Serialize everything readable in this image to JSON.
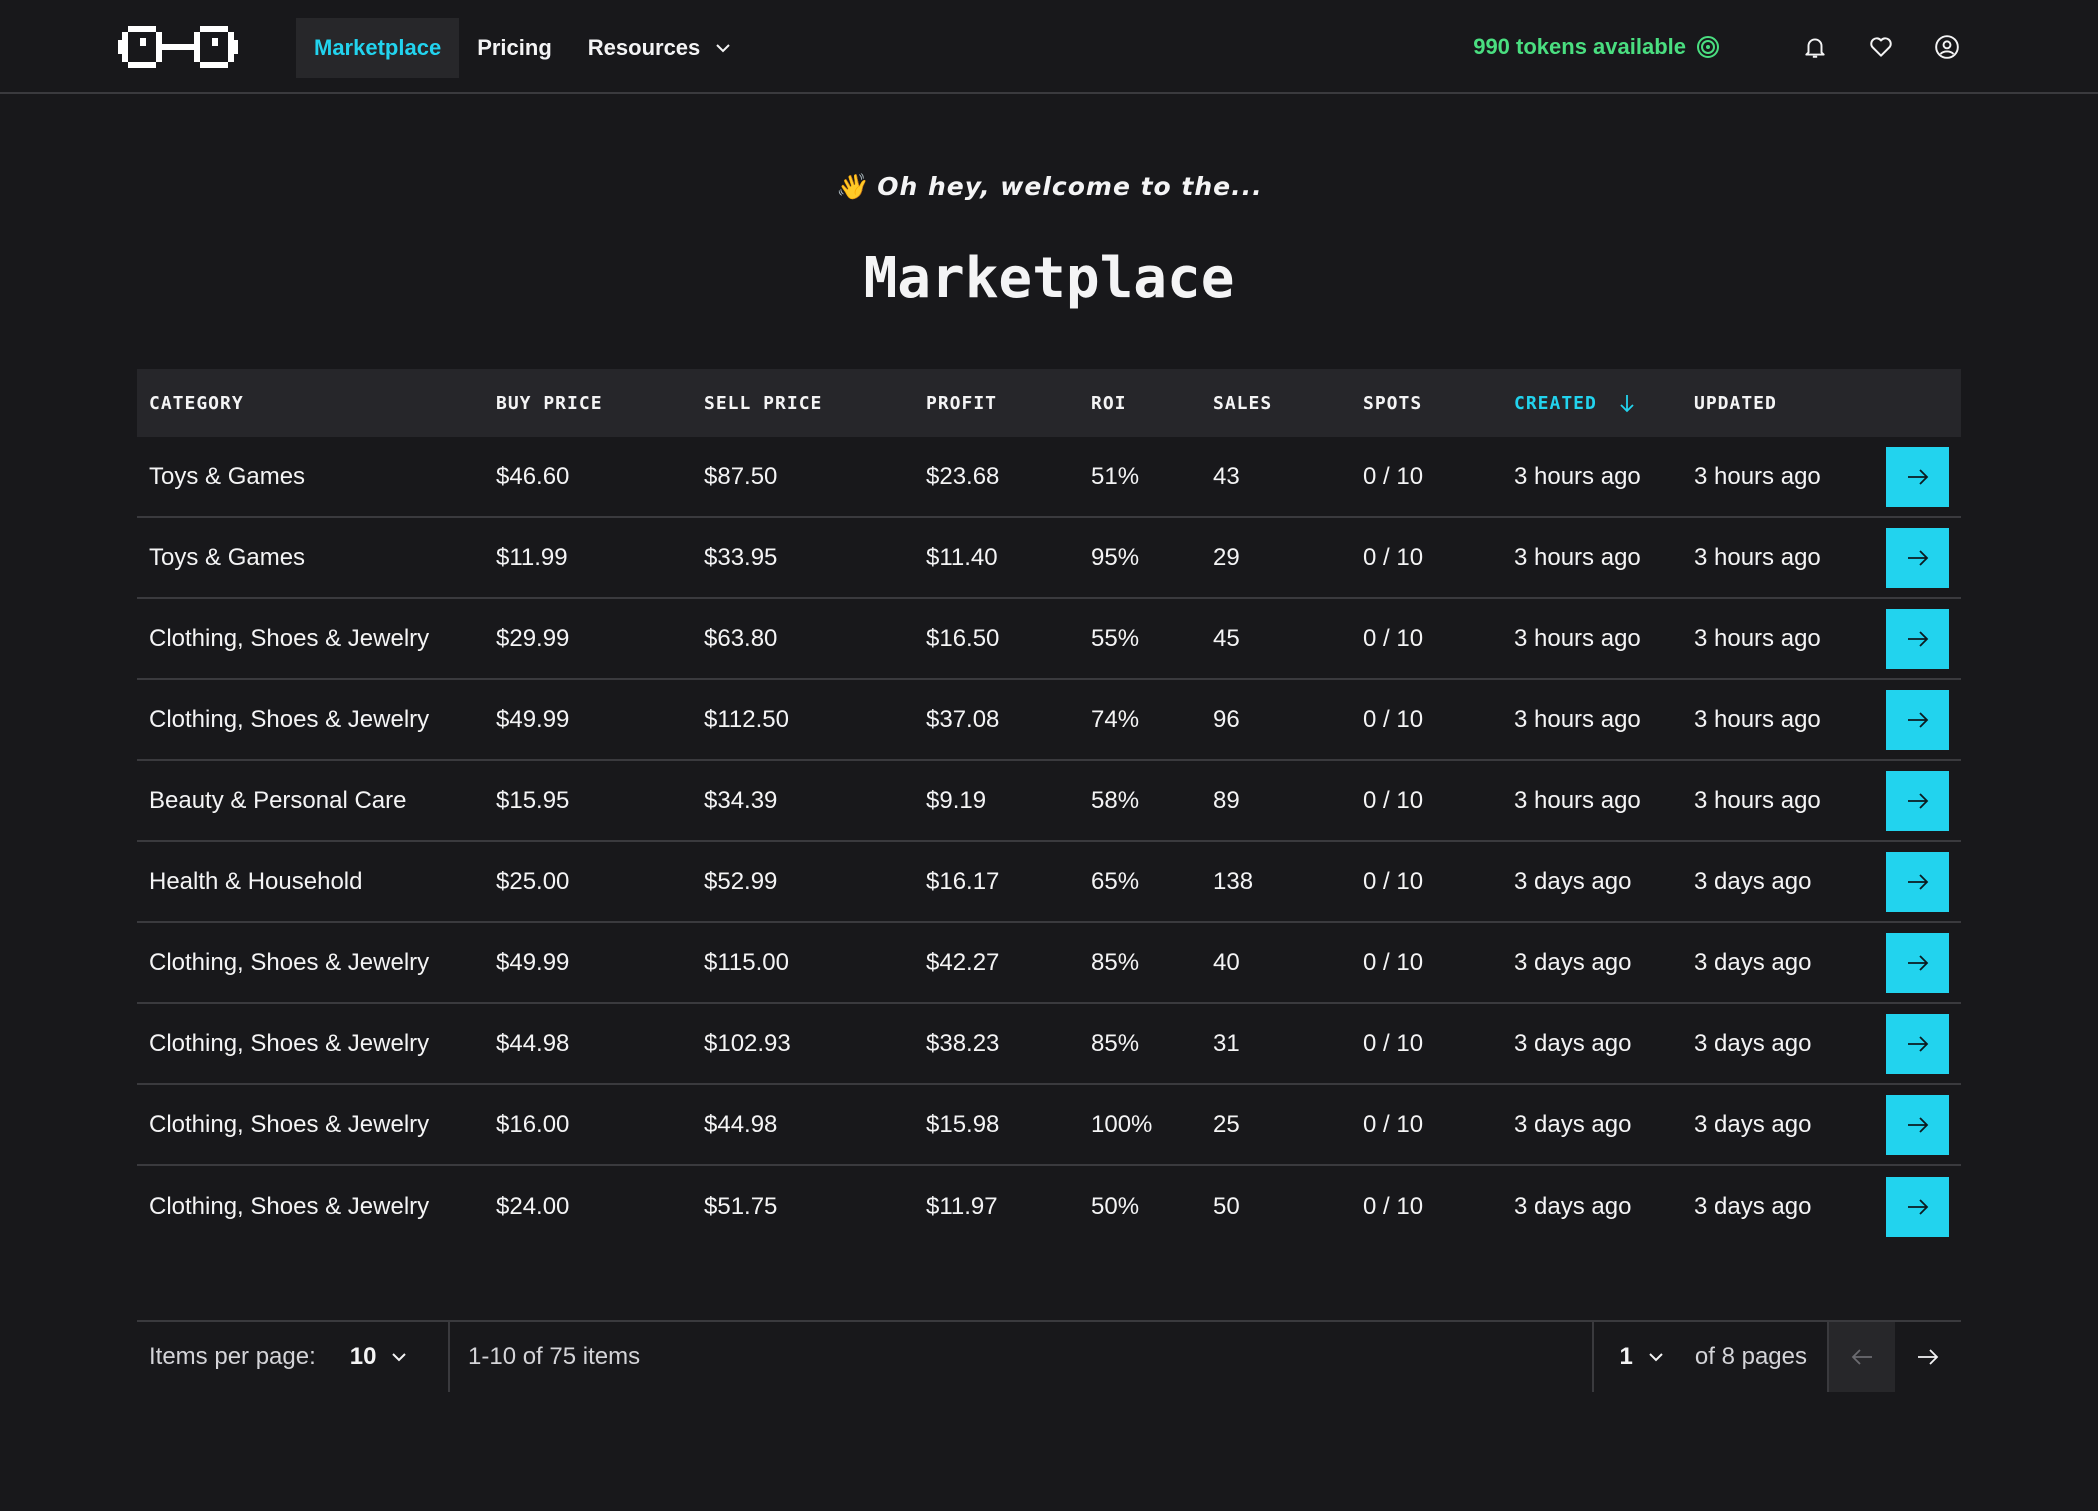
{
  "nav": {
    "links": [
      {
        "label": "Marketplace"
      },
      {
        "label": "Pricing"
      },
      {
        "label": "Resources"
      }
    ],
    "tokens_label": "990 tokens available"
  },
  "hero": {
    "subtitle": "Oh hey, welcome to the...",
    "wave_emoji": "👋",
    "title": "Marketplace"
  },
  "table": {
    "headers": {
      "category": "CATEGORY",
      "buy_price": "BUY PRICE",
      "sell_price": "SELL PRICE",
      "profit": "PROFIT",
      "roi": "ROI",
      "sales": "SALES",
      "spots": "SPOTS",
      "created": "CREATED",
      "updated": "UPDATED"
    },
    "rows": [
      {
        "category": "Toys & Games",
        "buy": "$46.60",
        "sell": "$87.50",
        "profit": "$23.68",
        "roi": "51%",
        "sales": "43",
        "spots": "0 / 10",
        "created": "3 hours ago",
        "updated": "3 hours ago"
      },
      {
        "category": "Toys & Games",
        "buy": "$11.99",
        "sell": "$33.95",
        "profit": "$11.40",
        "roi": "95%",
        "sales": "29",
        "spots": "0 / 10",
        "created": "3 hours ago",
        "updated": "3 hours ago"
      },
      {
        "category": "Clothing, Shoes & Jewelry",
        "buy": "$29.99",
        "sell": "$63.80",
        "profit": "$16.50",
        "roi": "55%",
        "sales": "45",
        "spots": "0 / 10",
        "created": "3 hours ago",
        "updated": "3 hours ago"
      },
      {
        "category": "Clothing, Shoes & Jewelry",
        "buy": "$49.99",
        "sell": "$112.50",
        "profit": "$37.08",
        "roi": "74%",
        "sales": "96",
        "spots": "0 / 10",
        "created": "3 hours ago",
        "updated": "3 hours ago"
      },
      {
        "category": "Beauty & Personal Care",
        "buy": "$15.95",
        "sell": "$34.39",
        "profit": "$9.19",
        "roi": "58%",
        "sales": "89",
        "spots": "0 / 10",
        "created": "3 hours ago",
        "updated": "3 hours ago"
      },
      {
        "category": "Health & Household",
        "buy": "$25.00",
        "sell": "$52.99",
        "profit": "$16.17",
        "roi": "65%",
        "sales": "138",
        "spots": "0 / 10",
        "created": "3 days ago",
        "updated": "3 days ago"
      },
      {
        "category": "Clothing, Shoes & Jewelry",
        "buy": "$49.99",
        "sell": "$115.00",
        "profit": "$42.27",
        "roi": "85%",
        "sales": "40",
        "spots": "0 / 10",
        "created": "3 days ago",
        "updated": "3 days ago"
      },
      {
        "category": "Clothing, Shoes & Jewelry",
        "buy": "$44.98",
        "sell": "$102.93",
        "profit": "$38.23",
        "roi": "85%",
        "sales": "31",
        "spots": "0 / 10",
        "created": "3 days ago",
        "updated": "3 days ago"
      },
      {
        "category": "Clothing, Shoes & Jewelry",
        "buy": "$16.00",
        "sell": "$44.98",
        "profit": "$15.98",
        "roi": "100%",
        "sales": "25",
        "spots": "0 / 10",
        "created": "3 days ago",
        "updated": "3 days ago"
      },
      {
        "category": "Clothing, Shoes & Jewelry",
        "buy": "$24.00",
        "sell": "$51.75",
        "profit": "$11.97",
        "roi": "50%",
        "sales": "50",
        "spots": "0 / 10",
        "created": "3 days ago",
        "updated": "3 days ago"
      }
    ]
  },
  "pagination": {
    "items_per_page_label": "Items per page:",
    "items_per_page_value": "10",
    "range_label": "1-10 of 75 items",
    "page_value": "1",
    "pages_label": "of 8 pages"
  },
  "colors": {
    "background": "#18181b",
    "accent": "#22d3ee",
    "tokens": "#4ade80",
    "header_bg": "#26262a"
  },
  "icons": [
    "logo-glasses",
    "chevron-down-icon",
    "coin-icon",
    "bell-icon",
    "heart-icon",
    "user-icon",
    "arrow-down-icon",
    "arrow-right-icon",
    "arrow-left-icon"
  ]
}
